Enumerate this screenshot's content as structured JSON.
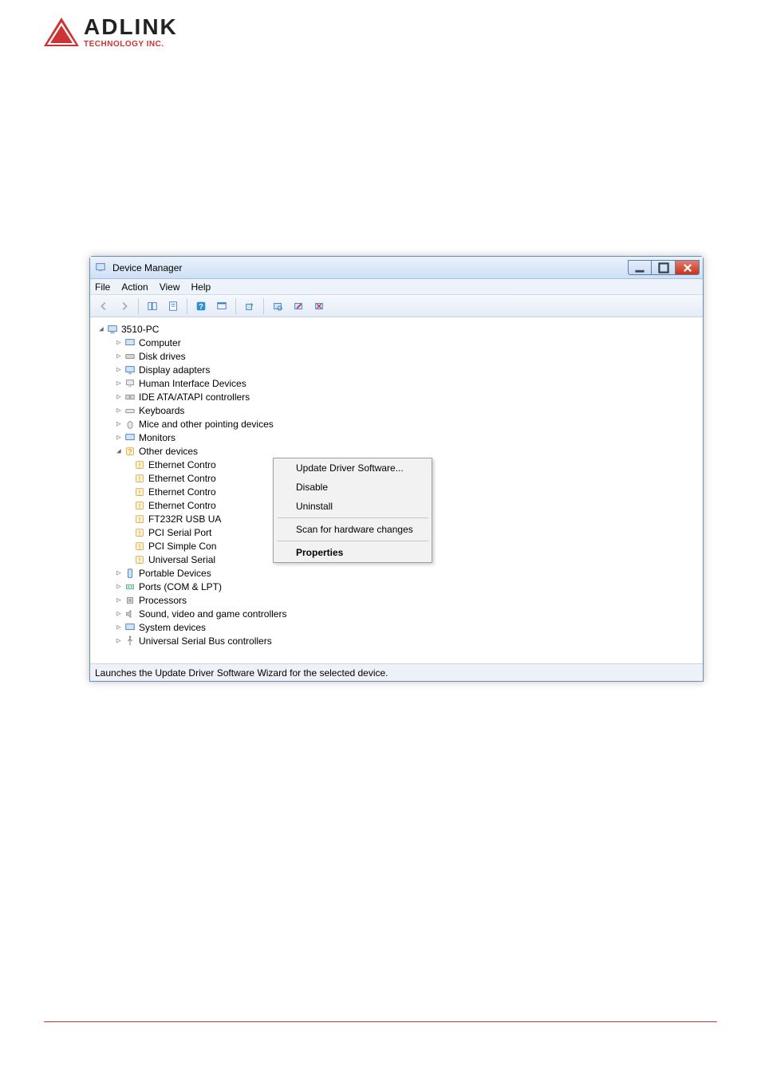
{
  "logo": {
    "title": "ADLINK",
    "subtitle": "TECHNOLOGY INC."
  },
  "window": {
    "title": "Device Manager",
    "menubar": [
      "File",
      "Action",
      "View",
      "Help"
    ],
    "statusbar": "Launches the Update Driver Software Wizard for the selected device.",
    "rootNode": "3510-PC",
    "categories": {
      "computer": "Computer",
      "disk": "Disk drives",
      "display": "Display adapters",
      "hid": "Human Interface Devices",
      "ide": "IDE ATA/ATAPI controllers",
      "keyboards": "Keyboards",
      "mice": "Mice and other pointing devices",
      "monitors": "Monitors",
      "other": "Other devices",
      "portable": "Portable Devices",
      "ports": "Ports (COM & LPT)",
      "processors": "Processors",
      "sound": "Sound, video and game controllers",
      "system": "System devices",
      "usb": "Universal Serial Bus controllers"
    },
    "otherDevices": {
      "eth0": "Ethernet Contro",
      "eth1": "Ethernet Contro",
      "eth2": "Ethernet Contro",
      "eth3": "Ethernet Contro",
      "ft232r": "FT232R USB UA",
      "pciserial": "PCI Serial Port",
      "pcisimple": "PCI Simple Con",
      "usbserial": "Universal Serial"
    },
    "contextMenu": {
      "update": "Update Driver Software...",
      "disable": "Disable",
      "uninstall": "Uninstall",
      "scan": "Scan for hardware changes",
      "properties": "Properties"
    }
  }
}
